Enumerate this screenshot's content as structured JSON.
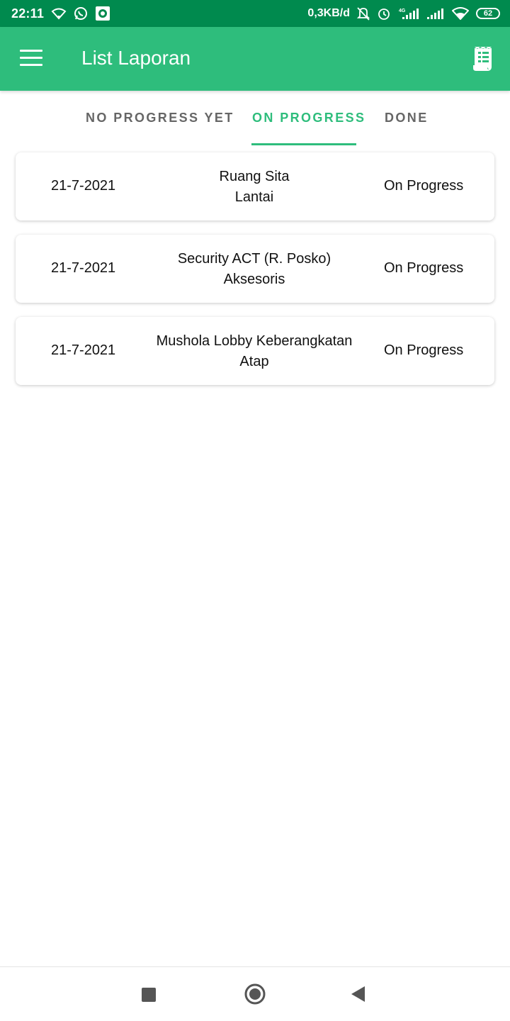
{
  "status_bar": {
    "time": "22:11",
    "speed": "0,3KB/d",
    "battery": "62",
    "icons_left": [
      "wifi-icon",
      "whatsapp-icon",
      "camera-icon"
    ],
    "icons_right": [
      "mute-bell-icon",
      "alarm-icon",
      "signal-4g-icon",
      "signal-icon",
      "wifi-icon",
      "battery-icon"
    ]
  },
  "app_bar": {
    "title": "List Laporan",
    "menu_icon": "hamburger-menu-icon",
    "action_icon": "report-icon"
  },
  "tabs": [
    {
      "label": "NO PROGRESS YET",
      "active": false
    },
    {
      "label": "ON PROGRESS",
      "active": true
    },
    {
      "label": "DONE",
      "active": false
    }
  ],
  "reports": [
    {
      "date": "21-7-2021",
      "location": "Ruang Sita",
      "category": "Lantai",
      "status": "On Progress"
    },
    {
      "date": "21-7-2021",
      "location": "Security ACT (R. Posko)",
      "category": "Aksesoris",
      "status": "On Progress"
    },
    {
      "date": "21-7-2021",
      "location": "Mushola Lobby Keberangkatan",
      "category": "Atap",
      "status": "On Progress"
    }
  ],
  "colors": {
    "status_bar": "#008a4e",
    "primary": "#2ebd7c",
    "tab_inactive": "#666666"
  },
  "nav_bar": {
    "icons": [
      "recents-icon",
      "home-icon",
      "back-icon"
    ]
  }
}
